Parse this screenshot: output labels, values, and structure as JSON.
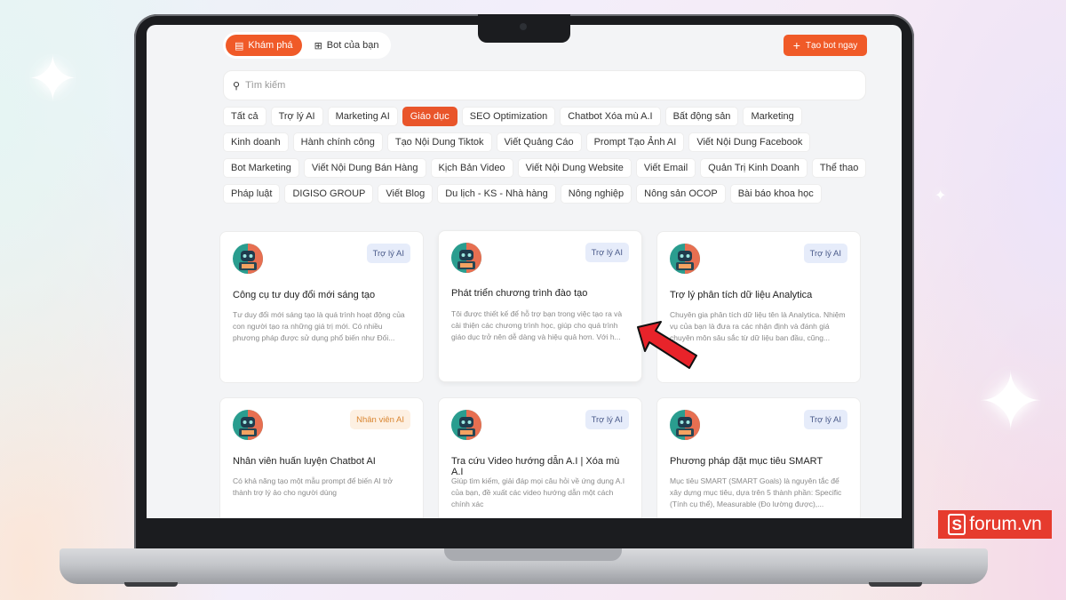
{
  "header": {
    "tabs": [
      {
        "label": "Khám phá",
        "icon": "grid-icon",
        "active": true
      },
      {
        "label": "Bot của bạn",
        "icon": "apps-icon",
        "active": false
      }
    ],
    "create_button": "Tạo bot ngay"
  },
  "search": {
    "placeholder": "Tìm kiếm"
  },
  "categories": [
    "Tất cả",
    "Trợ lý AI",
    "Marketing AI",
    "Giáo dục",
    "SEO Optimization",
    "Chatbot Xóa mù A.I",
    "Bất động sản",
    "Marketing",
    "Kinh doanh",
    "Hành chính công",
    "Tạo Nội Dung Tiktok",
    "Viết Quảng Cáo",
    "Prompt Tạo Ảnh AI",
    "Viết Nội Dung Facebook",
    "Bot Marketing",
    "Viết Nội Dung Bán Hàng",
    "Kịch Bản Video",
    "Viết Nội Dung Website",
    "Viết Email",
    "Quản Trị Kinh Doanh",
    "Thể thao",
    "Pháp luật",
    "DIGISO GROUP",
    "Viết Blog",
    "Du lịch - KS - Nhà hàng",
    "Nông nghiệp",
    "Nông sản OCOP",
    "Bài báo khoa học"
  ],
  "active_category": "Giáo dục",
  "cards": [
    {
      "badge": "Trợ lý AI",
      "badge_type": "ai",
      "title": "Công cụ tư duy đổi mới sáng tạo",
      "desc": "Tư duy đổi mới sáng tạo là quá trình hoạt động của con người tạo ra những giá trị mới. Có nhiều phương pháp được sử dụng phổ biến như Đối..."
    },
    {
      "badge": "Trợ lý AI",
      "badge_type": "ai",
      "title": "Phát triển chương trình đào tạo",
      "desc": "Tôi được thiết kế để hỗ trợ bạn trong việc tạo ra và cải thiện các chương trình học, giúp cho quá trình giáo dục trở nên dễ dàng và hiệu quả hơn. Với h..."
    },
    {
      "badge": "Trợ lý AI",
      "badge_type": "ai",
      "title": "Trợ lý phân tích dữ liệu Analytica",
      "desc": "Chuyên gia phân tích dữ liệu tên là Analytica. Nhiệm vụ của bạn là đưa ra các nhận định và đánh giá chuyên môn sâu sắc từ dữ liệu ban đầu, cũng..."
    },
    {
      "badge": "Nhân viên AI",
      "badge_type": "staff",
      "title": "Nhân viên huấn luyện Chatbot AI",
      "desc": "Có khả năng tạo một mẫu prompt để biến AI trở thành trợ lý ảo cho người dùng"
    },
    {
      "badge": "Trợ lý AI",
      "badge_type": "ai",
      "title": "Tra cứu Video hướng dẫn A.I | Xóa mù A.I",
      "desc": "Giúp tìm kiếm, giải đáp mọi câu hỏi về ứng dụng A.I của bạn, đề xuất các video hướng dẫn một cách chính xác"
    },
    {
      "badge": "Trợ lý AI",
      "badge_type": "ai",
      "title": "Phương pháp đặt mục tiêu SMART",
      "desc": "Mục tiêu SMART (SMART Goals) là nguyên tắc để xây dựng mục tiêu, dựa trên 5 thành phần: Specific (Tính cụ thể), Measurable (Đo lường được),..."
    }
  ],
  "watermark": {
    "mark": "S",
    "text": "forum.vn"
  },
  "colors": {
    "accent": "#f05a28",
    "badge_ai_bg": "#e6ecfa",
    "badge_staff_bg": "#fdf0e2",
    "arrow": "#e8232a"
  }
}
